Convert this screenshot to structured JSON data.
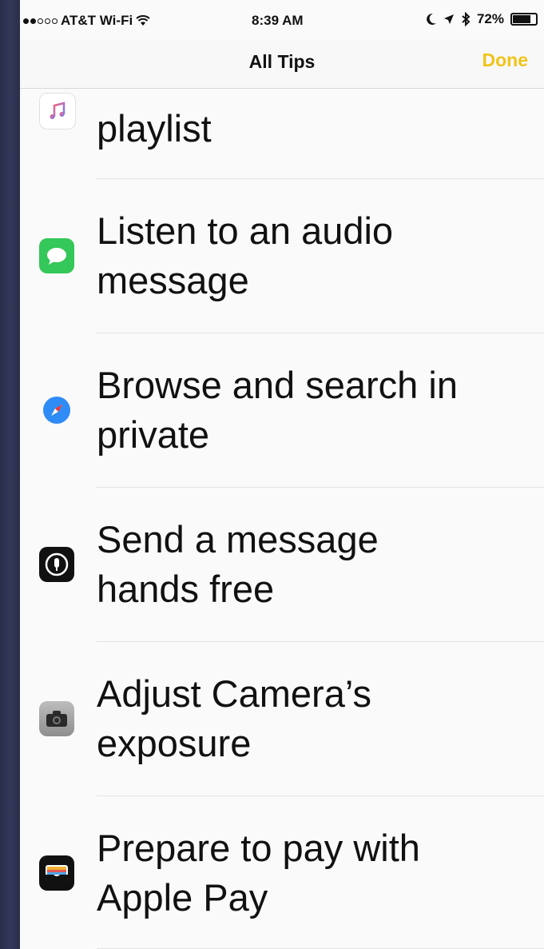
{
  "status_bar": {
    "carrier": "AT&T Wi-Fi",
    "time": "8:39 AM",
    "battery": "72%",
    "battery_level": 0.72
  },
  "nav": {
    "title": "All Tips",
    "done_label": "Done"
  },
  "tips": [
    {
      "icon": "music-icon",
      "text": "playlist"
    },
    {
      "icon": "messages-icon",
      "line1": "Listen to an audio",
      "line2": "message"
    },
    {
      "icon": "safari-icon",
      "line1": "Browse and search in",
      "line2": "private"
    },
    {
      "icon": "siri-icon",
      "line1": "Send a message",
      "line2": "hands free"
    },
    {
      "icon": "camera-icon",
      "line1": "Adjust Camera’s",
      "line2": "exposure"
    },
    {
      "icon": "wallet-icon",
      "line1": "Prepare to pay with",
      "line2": "Apple Pay"
    }
  ],
  "colors": {
    "accent": "#f0c419",
    "messages_green": "#34c759",
    "safari_blue": "#2f8bf5"
  }
}
